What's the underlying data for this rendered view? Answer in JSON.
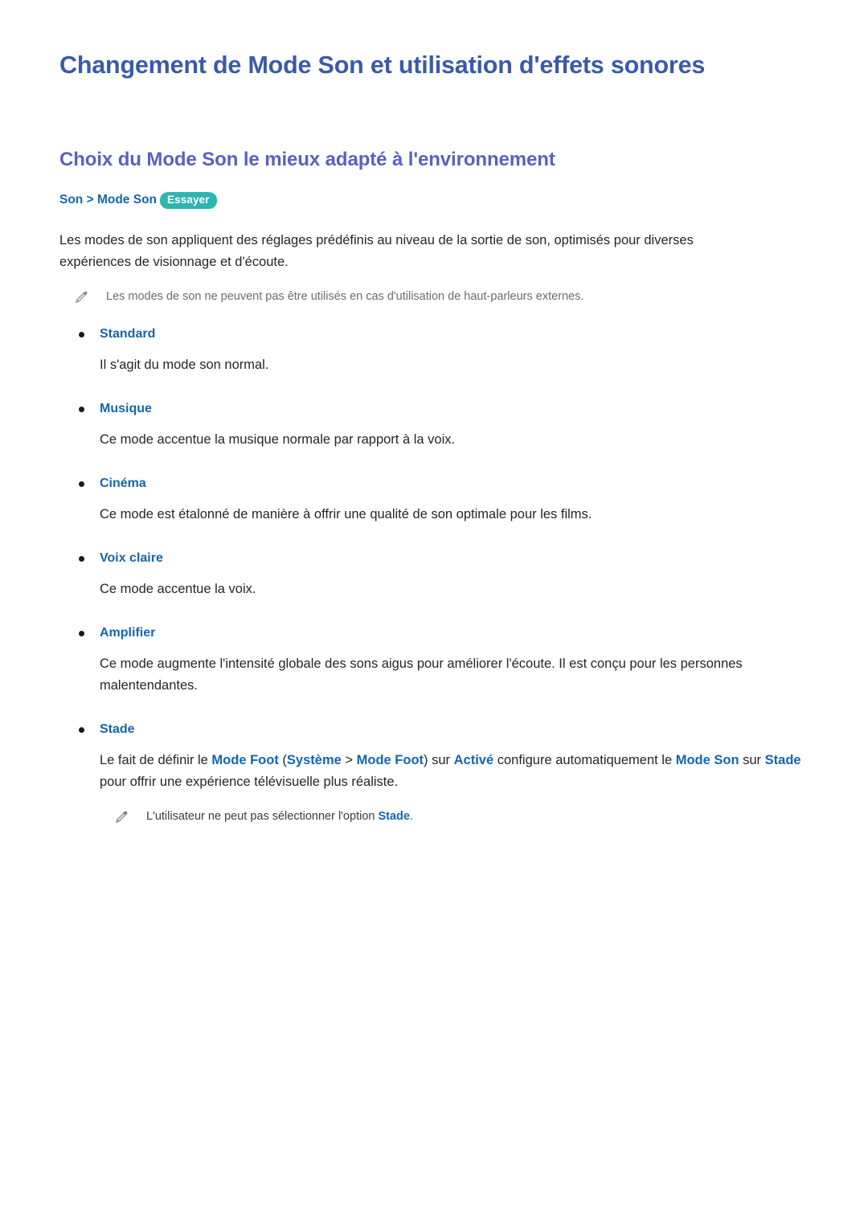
{
  "page": {
    "title": "Changement de Mode Son et utilisation d'effets sonores",
    "section_title": "Choix du Mode Son le mieux adapté à l'environnement"
  },
  "breadcrumb": {
    "root": "Son",
    "separator": " > ",
    "leaf": "Mode Son",
    "badge": "Essayer"
  },
  "intro": {
    "text": "Les modes de son appliquent des réglages prédéfinis au niveau de la sortie de son, optimisés pour diverses expériences de visionnage et d'écoute."
  },
  "notes": {
    "top": {
      "icon": "pencil-icon",
      "text": "Les modes de son ne peuvent pas être utilisés en cas d'utilisation de haut-parleurs externes."
    },
    "bottom": {
      "icon": "pencil-icon",
      "prefix": "L'utilisateur ne peut pas sélectionner l'option ",
      "emphasis": "Stade",
      "suffix": "."
    }
  },
  "modes": [
    {
      "name": "Standard",
      "description": "Il s'agit du mode son normal."
    },
    {
      "name": "Musique",
      "description": "Ce mode accentue la musique normale par rapport à la voix."
    },
    {
      "name": "Cinéma",
      "description": "Ce mode est étalonné de manière à offrir une qualité de son optimale pour les films."
    },
    {
      "name": "Voix claire",
      "description": "Ce mode accentue la voix."
    },
    {
      "name": "Amplifier",
      "description": "Ce mode augmente l'intensité globale des sons aigus pour améliorer l'écoute. Il est conçu pour les personnes malentendantes."
    },
    {
      "name": "Stade",
      "description": ""
    }
  ],
  "stade_paragraph": {
    "seg1": "Le fait de définir le ",
    "b1": "Mode Foot",
    "seg2": " (",
    "b2": "Système",
    "seg3": " > ",
    "b3": "Mode Foot",
    "seg4": ") sur ",
    "b4": "Activé",
    "seg5": " configure automatiquement le ",
    "b5": "Mode Son",
    "seg6": " sur ",
    "b6": "Stade",
    "seg7": " pour offrir une expérience télévisuelle plus réaliste."
  },
  "colors": {
    "h1": "#3a5ba8",
    "h2": "#5b60c2",
    "accent_blue": "#1565b0",
    "badge_teal": "#2bb6ae",
    "body_text": "#262626",
    "note_gray": "#6b6b73"
  }
}
